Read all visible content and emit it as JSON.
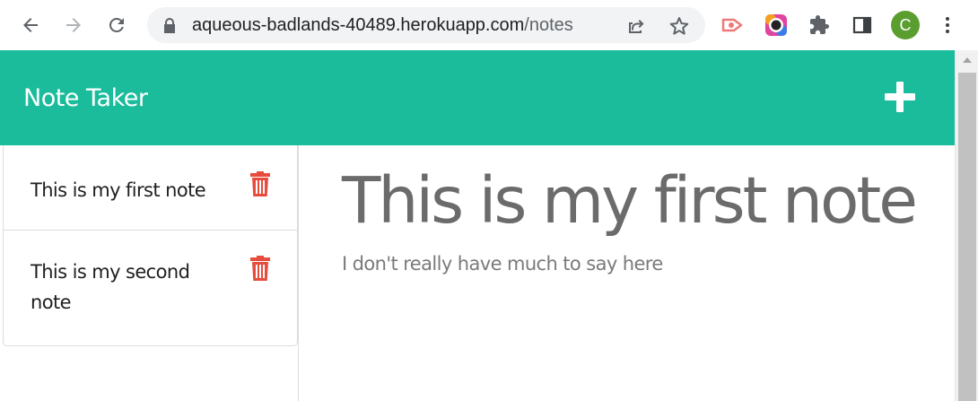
{
  "browser": {
    "url_domain": "aqueous-badlands-40489.herokuapp.com",
    "url_path": "/notes",
    "profile_initial": "C"
  },
  "header": {
    "brand": "Note Taker",
    "new_note_icon": "plus-icon"
  },
  "notes": [
    {
      "title": "This is my first note"
    },
    {
      "title": "This is my second note"
    }
  ],
  "active_note": {
    "title": "This is my first note",
    "text": "I don't really have much to say here"
  },
  "colors": {
    "accent": "#1abc9c",
    "delete": "#e74c3c"
  }
}
